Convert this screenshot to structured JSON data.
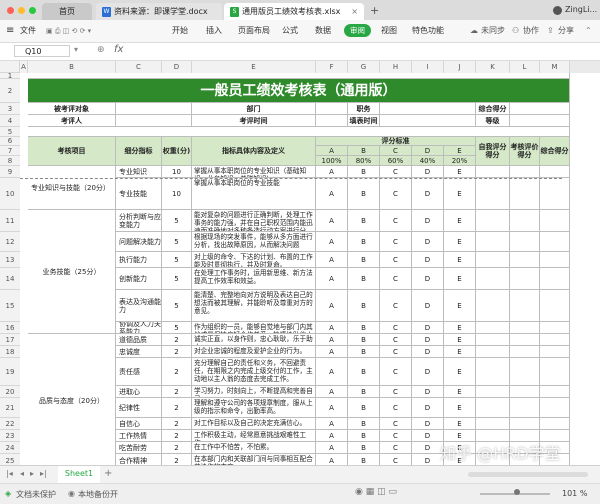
{
  "window": {
    "tabs": [
      {
        "label": "首页",
        "active": false
      },
      {
        "label": "资料来源：即课学堂.docx",
        "active": false
      },
      {
        "label": "通用版员工绩效考核表.xlsx",
        "active": true
      }
    ],
    "user": "ZingLi..."
  },
  "menu": {
    "file": "文件",
    "items": [
      "开始",
      "插入",
      "页面布局",
      "公式",
      "数据",
      "审阅",
      "视图",
      "特色功能"
    ],
    "sync": "未同步",
    "collab": "协作",
    "share": "分享"
  },
  "formula": {
    "cell_ref": "Q10",
    "fx": "fx",
    "content": ""
  },
  "columns": [
    "A",
    "B",
    "C",
    "D",
    "E",
    "F",
    "G",
    "H",
    "I",
    "J",
    "K",
    "L",
    "M"
  ],
  "rows": [
    "1",
    "2",
    "3",
    "4",
    "5",
    "6",
    "7",
    "8",
    "9",
    "10",
    "11",
    "12",
    "13",
    "14",
    "15",
    "16",
    "17",
    "18",
    "19",
    "20",
    "21",
    "22",
    "23",
    "24",
    "25"
  ],
  "sheet": {
    "title": "一般员工绩效考核表（通用版）",
    "r3": {
      "a": "被考评对象",
      "dept": "部门",
      "job": "职务",
      "score": "综合得分"
    },
    "r4": {
      "a": "考评人",
      "time": "考评时间",
      "fill_time": "填表时间",
      "grade": "等级"
    },
    "header": {
      "item": "考核项目",
      "indicator": "细分指标",
      "weight": "权重(分)",
      "content": "指标具体内容及定义",
      "standard": "评分标准",
      "self": "自我评分得分",
      "reviewer": "考核评价得分",
      "total": "综合得分",
      "grades": [
        "A",
        "B",
        "C",
        "D",
        "E"
      ],
      "percents": [
        "100%",
        "80%",
        "60%",
        "40%",
        "20%"
      ]
    },
    "groups": [
      {
        "name": "专业知识与技能（20分）"
      },
      {
        "name": "业务技能（25分）"
      },
      {
        "name": "品质与态度（20分）"
      }
    ],
    "items": [
      {
        "name": "专业知识",
        "weight": "10",
        "content": "掌握从事本职岗位的专业知识（基础知识、业务知识、关联知识）"
      },
      {
        "name": "专业技能",
        "weight": "10",
        "content": "掌握从事本职岗位的专业技能"
      },
      {
        "name": "分析判断与应变能力",
        "weight": "5",
        "content": "能对复杂的问题进行正确判断，处理工作事务的能力强，并在自己职权范围内能迅速而准确地对多种备选行动方案进行分析，并作出最佳决定。"
      },
      {
        "name": "问题解决能力",
        "weight": "5",
        "content": "根据现场的突发事件，能够从多方面进行分析，找出故障原因，从而解决问题"
      },
      {
        "name": "执行能力",
        "weight": "5",
        "content": "对上级的命令、下达的计划、布置的工作能及时贯彻执行，并及时复命。"
      },
      {
        "name": "创新能力",
        "weight": "5",
        "content": "在处理工作事务时，运用新思维、新方法提高工作效率和效益。"
      },
      {
        "name": "表达及沟通能力",
        "weight": "5",
        "content": "能清楚、完整地向对方说明及表达自己的想法而被其理解，并能聆听及尊重对方的意见。"
      },
      {
        "name": "协调及人力关系能力",
        "weight": "5",
        "content": "作为组织的一员，能够自觉地与部门内其他成员保持良好合作关系，热情协助他人的工作，积极参加公司及部门内部的各种活动，维护良好的同事关系。"
      },
      {
        "name": "道德品质",
        "weight": "2",
        "content": "诚实正直，以身作则，忠心耿耿，乐于助人。"
      },
      {
        "name": "忠诚度",
        "weight": "2",
        "content": "对企业忠诚的程度及爱护企业的行为。"
      },
      {
        "name": "责任感",
        "weight": "2",
        "content": "充分理解自己的责任和义务，不回避责任，在期限之内完成上级交付的工作，主动地以主人翁的态度去完成工作。"
      },
      {
        "name": "进取心",
        "weight": "2",
        "content": "学习努力，时刻向上，不断提高和完善自己。"
      },
      {
        "name": "纪律性",
        "weight": "2",
        "content": "理解和遵守公司的各项规章制度，服从上级的指示和命令，出勤率高。"
      },
      {
        "name": "自信心",
        "weight": "2",
        "content": "对工作目标以及自己的决定充满信心。"
      },
      {
        "name": "工作热情",
        "weight": "2",
        "content": "工作积极主动，经常愿意挑战艰难性工作。"
      },
      {
        "name": "吃苦耐劳",
        "weight": "2",
        "content": "在工作中不怕苦，不怕累。"
      },
      {
        "name": "合作精神",
        "weight": "2",
        "content": "在本部门内和关联部门间与同事相互配合共协作的态度。"
      }
    ]
  },
  "bottom": {
    "sheet_tab": "Sheet1",
    "doc_status": "文档未保护",
    "backup": "本地备份开",
    "zoom": "101 %",
    "watermark": "知乎 @HRD学堂"
  },
  "colors": {
    "accent": "#29a744",
    "title_bg": "#2f8a2b",
    "header_bg": "#d5e8c8"
  }
}
